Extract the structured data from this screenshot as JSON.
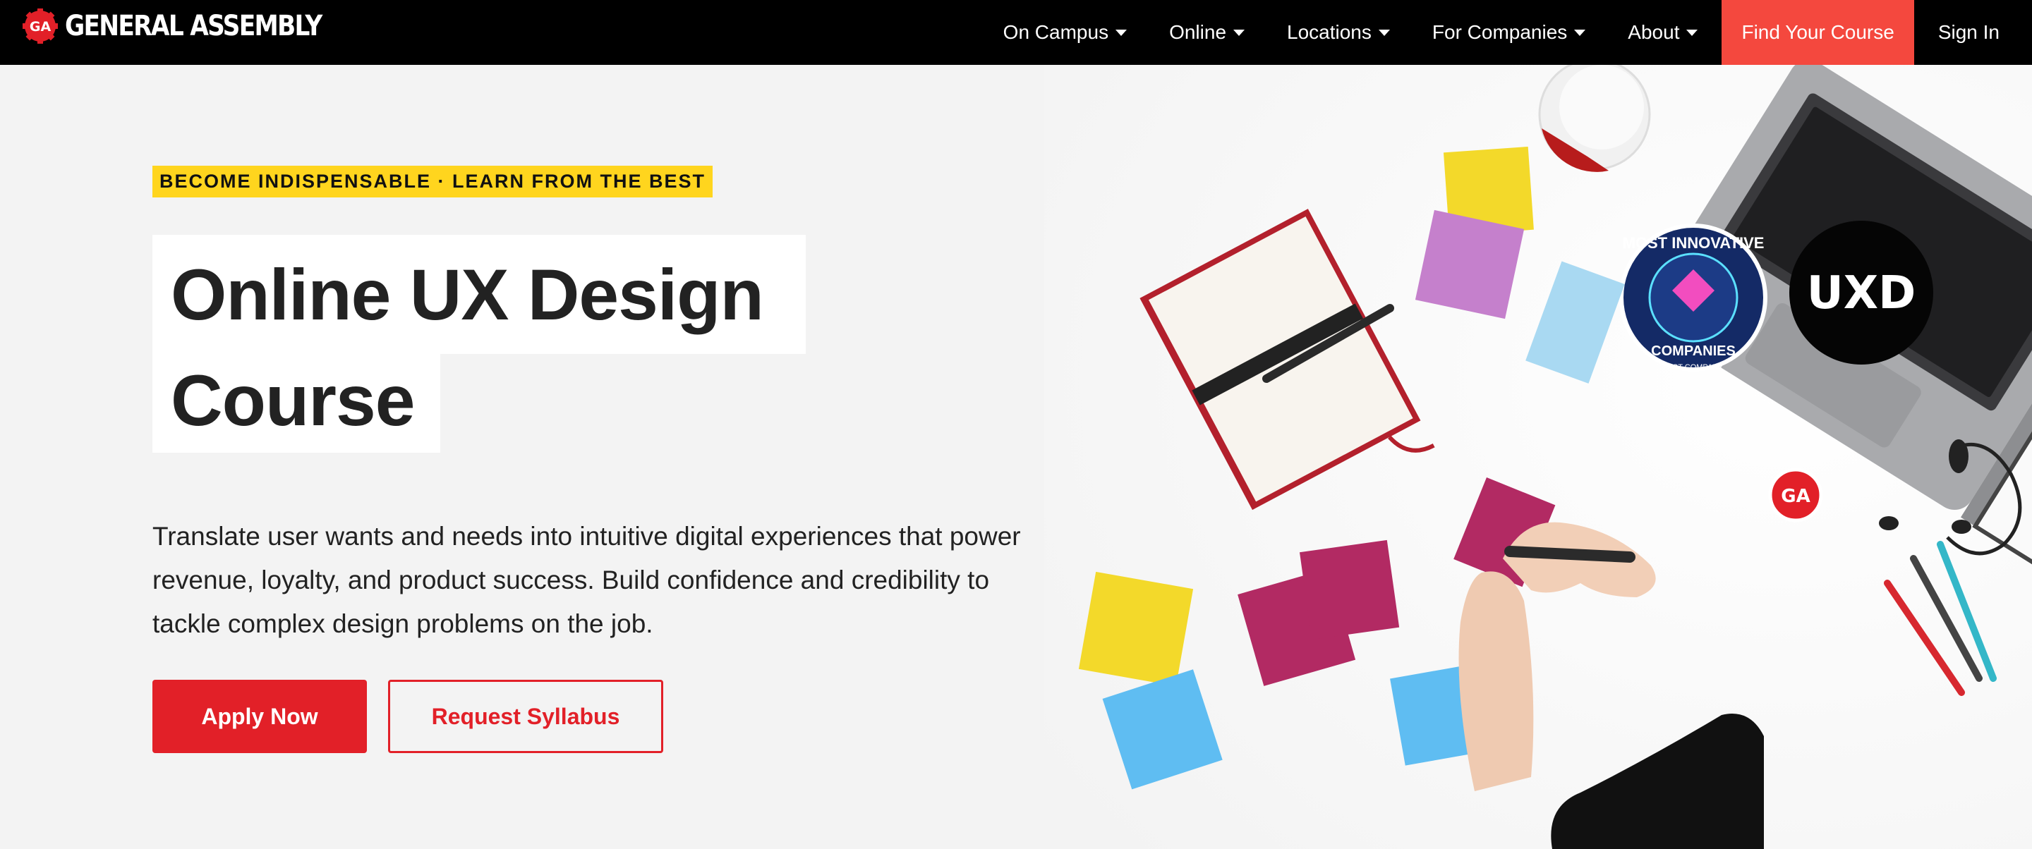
{
  "brand": {
    "name": "GENERAL ASSEMBLY",
    "badge": "GA"
  },
  "nav": {
    "items": [
      {
        "label": "On Campus"
      },
      {
        "label": "Online"
      },
      {
        "label": "Locations"
      },
      {
        "label": "For Companies"
      },
      {
        "label": "About"
      }
    ],
    "cta": "Find Your Course",
    "signin": "Sign In"
  },
  "hero": {
    "eyebrow": "BECOME INDISPENSABLE · LEARN FROM THE BEST",
    "title_line1": "Online UX Design",
    "title_line2": "Course",
    "description": "Translate user wants and needs into intuitive digital experiences that power revenue, loyalty, and product success. Build confidence and credibility to tackle complex design problems on the job.",
    "primary_button": "Apply Now",
    "secondary_button": "Request Syllabus"
  },
  "image": {
    "badge_text": "UXD",
    "sticker_top": "MOST INNOVATIVE",
    "sticker_bottom": "COMPANIES",
    "sticker_footer": "FAST COMPANY",
    "ga_sticker": "GA"
  },
  "colors": {
    "nav_bg": "#000000",
    "accent_red": "#e22028",
    "cta_red": "#f4483e",
    "eyebrow_yellow": "#ffd51e",
    "page_bg": "#f3f3f3"
  }
}
